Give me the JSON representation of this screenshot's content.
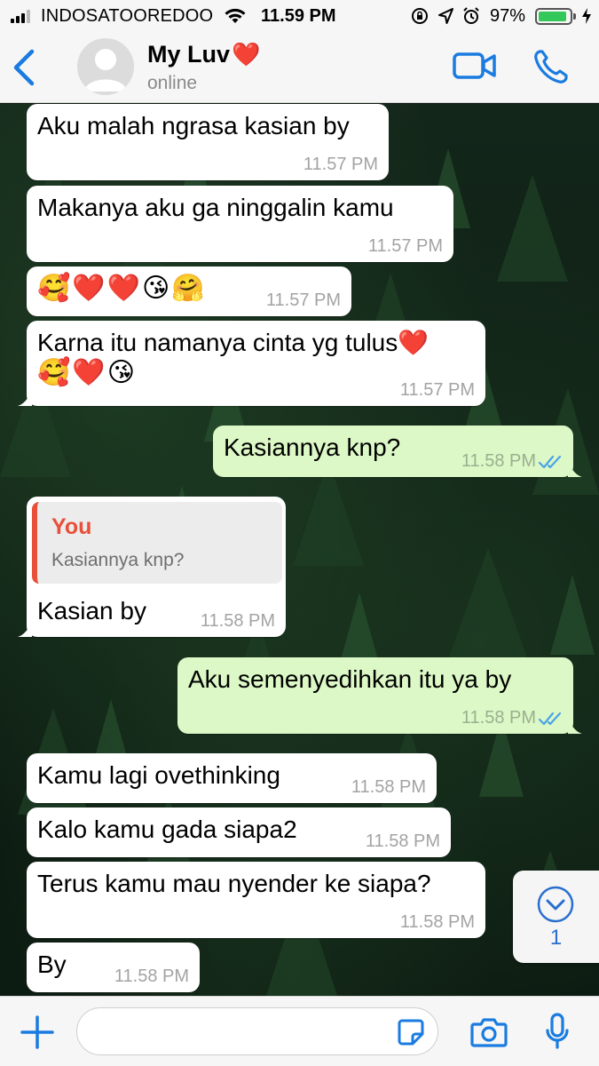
{
  "status_bar": {
    "carrier": "INDOSATOOREDOO",
    "time": "11.59 PM",
    "battery_percent": "97%",
    "battery_level": 0.97
  },
  "header": {
    "back_icon": "chevron-left-icon",
    "contact_name": "My Luv",
    "name_emoji": "❤️",
    "status": "online",
    "accent_color": "#1a7be0"
  },
  "messages": [
    {
      "dir": "in",
      "text": "Aku malah ngrasa kasian by",
      "time": "11.57 PM"
    },
    {
      "dir": "in",
      "text": "Makanya aku ga ninggalin kamu",
      "time": "11.57 PM"
    },
    {
      "dir": "in",
      "text": "🥰❤️❤️😘🤗",
      "time": "11.57 PM"
    },
    {
      "dir": "in",
      "text": "Karna itu namanya cinta yg tulus❤️",
      "text2": "🥰❤️😘",
      "time": "11.57 PM"
    },
    {
      "dir": "out",
      "text": "Kasiannya knp?",
      "time": "11.58 PM",
      "read": true
    },
    {
      "dir": "in",
      "quote_name": "You",
      "quote_text": "Kasiannya knp?",
      "text": "Kasian by",
      "time": "11.58 PM"
    },
    {
      "dir": "out",
      "text": "Aku semenyedihkan itu ya by",
      "time": "11.58 PM",
      "read": true
    },
    {
      "dir": "in",
      "text": "Kamu lagi ovethinking",
      "time": "11.58 PM"
    },
    {
      "dir": "in",
      "text": "Kalo kamu gada siapa2",
      "time": "11.58 PM"
    },
    {
      "dir": "in",
      "text": "Terus kamu mau nyender ke siapa?",
      "time": "11.58 PM"
    },
    {
      "dir": "in",
      "text": "By",
      "time": "11.58 PM"
    }
  ],
  "scroll_down": {
    "unread_count": "1"
  },
  "input": {
    "placeholder": "",
    "value": ""
  }
}
